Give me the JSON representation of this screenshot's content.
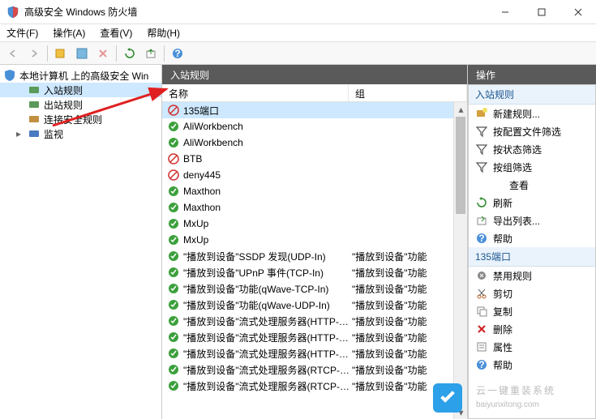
{
  "window": {
    "title": "高级安全 Windows 防火墙"
  },
  "menu": {
    "file": "文件(F)",
    "action": "操作(A)",
    "view": "查看(V)",
    "help": "帮助(H)"
  },
  "tree": {
    "root": "本地计算机 上的高级安全 Win",
    "items": [
      {
        "label": "入站规则",
        "selected": true
      },
      {
        "label": "出站规则",
        "selected": false
      },
      {
        "label": "连接安全规则",
        "selected": false
      },
      {
        "label": "监视",
        "selected": false
      }
    ]
  },
  "center": {
    "header": "入站规则",
    "columns": {
      "name": "名称",
      "group": "组"
    },
    "rules": [
      {
        "name": "135端口",
        "group": "",
        "status": "blocked",
        "selected": true
      },
      {
        "name": "AliWorkbench",
        "group": "",
        "status": "allowed"
      },
      {
        "name": "AliWorkbench",
        "group": "",
        "status": "allowed"
      },
      {
        "name": "BTB",
        "group": "",
        "status": "blocked"
      },
      {
        "name": "deny445",
        "group": "",
        "status": "blocked"
      },
      {
        "name": "Maxthon",
        "group": "",
        "status": "allowed"
      },
      {
        "name": "Maxthon",
        "group": "",
        "status": "allowed"
      },
      {
        "name": "MxUp",
        "group": "",
        "status": "allowed"
      },
      {
        "name": "MxUp",
        "group": "",
        "status": "allowed"
      },
      {
        "name": "\"播放到设备\"SSDP 发现(UDP-In)",
        "group": "\"播放到设备\"功能",
        "status": "allowed"
      },
      {
        "name": "\"播放到设备\"UPnP 事件(TCP-In)",
        "group": "\"播放到设备\"功能",
        "status": "allowed"
      },
      {
        "name": "\"播放到设备\"功能(qWave-TCP-In)",
        "group": "\"播放到设备\"功能",
        "status": "allowed"
      },
      {
        "name": "\"播放到设备\"功能(qWave-UDP-In)",
        "group": "\"播放到设备\"功能",
        "status": "allowed"
      },
      {
        "name": "\"播放到设备\"流式处理服务器(HTTP-Stre...",
        "group": "\"播放到设备\"功能",
        "status": "allowed"
      },
      {
        "name": "\"播放到设备\"流式处理服务器(HTTP-Stre...",
        "group": "\"播放到设备\"功能",
        "status": "allowed"
      },
      {
        "name": "\"播放到设备\"流式处理服务器(HTTP-Stre...",
        "group": "\"播放到设备\"功能",
        "status": "allowed"
      },
      {
        "name": "\"播放到设备\"流式处理服务器(RTCP-Stre...",
        "group": "\"播放到设备\"功能",
        "status": "allowed"
      },
      {
        "name": "\"播放到设备\"流式处理服务器(RTCP-Stre...",
        "group": "\"播放到设备\"功能",
        "status": "allowed"
      }
    ]
  },
  "actions": {
    "header": "操作",
    "section1": "入站规则",
    "items1": [
      {
        "label": "新建规则...",
        "icon": "new-rule"
      },
      {
        "label": "按配置文件筛选",
        "icon": "filter"
      },
      {
        "label": "按状态筛选",
        "icon": "filter"
      },
      {
        "label": "按组筛选",
        "icon": "filter"
      },
      {
        "label": "查看",
        "icon": "none",
        "indent": true
      },
      {
        "label": "刷新",
        "icon": "refresh"
      },
      {
        "label": "导出列表...",
        "icon": "export"
      },
      {
        "label": "帮助",
        "icon": "help"
      }
    ],
    "section2": "135端口",
    "items2": [
      {
        "label": "禁用规则",
        "icon": "disable"
      },
      {
        "label": "剪切",
        "icon": "cut"
      },
      {
        "label": "复制",
        "icon": "copy"
      },
      {
        "label": "删除",
        "icon": "delete"
      },
      {
        "label": "属性",
        "icon": "props"
      },
      {
        "label": "帮助",
        "icon": "help"
      }
    ]
  },
  "watermark": "云一键重装系统",
  "watermark_sub": "baiyunxitong.com"
}
